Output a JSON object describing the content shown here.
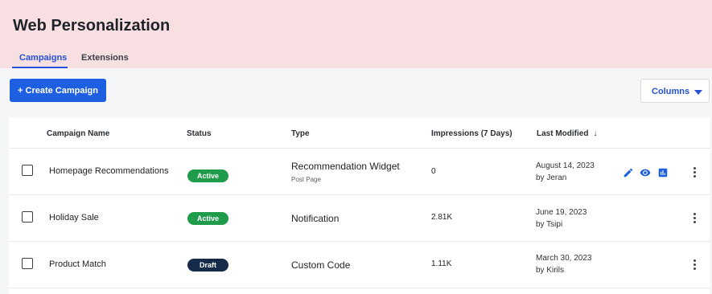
{
  "header": {
    "title": "Web Personalization",
    "tabs": [
      {
        "label": "Campaigns",
        "active": true
      },
      {
        "label": "Extensions",
        "active": false
      }
    ]
  },
  "toolbar": {
    "create_label": "+ Create Campaign",
    "columns_label": "Columns"
  },
  "table": {
    "columns": [
      "Campaign Name",
      "Status",
      "Type",
      "Impressions (7 Days)",
      "Last Modified"
    ],
    "sort_indicator": "↓",
    "rows": [
      {
        "name": "Homepage Recommendations",
        "status": "Active",
        "type": "Recommendation Widget",
        "subtype": "Post Page",
        "impressions": "0",
        "modified_date": "August 14, 2023",
        "modified_by": "by Jeran"
      },
      {
        "name": "Holiday Sale",
        "status": "Active",
        "type": "Notification",
        "subtype": "",
        "impressions": "2.81K",
        "modified_date": "June 19, 2023",
        "modified_by": "by Tsipi"
      },
      {
        "name": "Product Match",
        "status": "Draft",
        "type": "Custom Code",
        "subtype": "",
        "impressions": "1.11K",
        "modified_date": "March 30, 2023",
        "modified_by": "by Kirils"
      }
    ]
  },
  "row_actions": [
    "pencil-icon",
    "eye-icon",
    "chart-icon"
  ],
  "colors": {
    "header_bg": "#f8dfe1",
    "accent": "#1d5fe0",
    "active_badge": "#1e9b4b",
    "draft_badge": "#162a4a"
  }
}
